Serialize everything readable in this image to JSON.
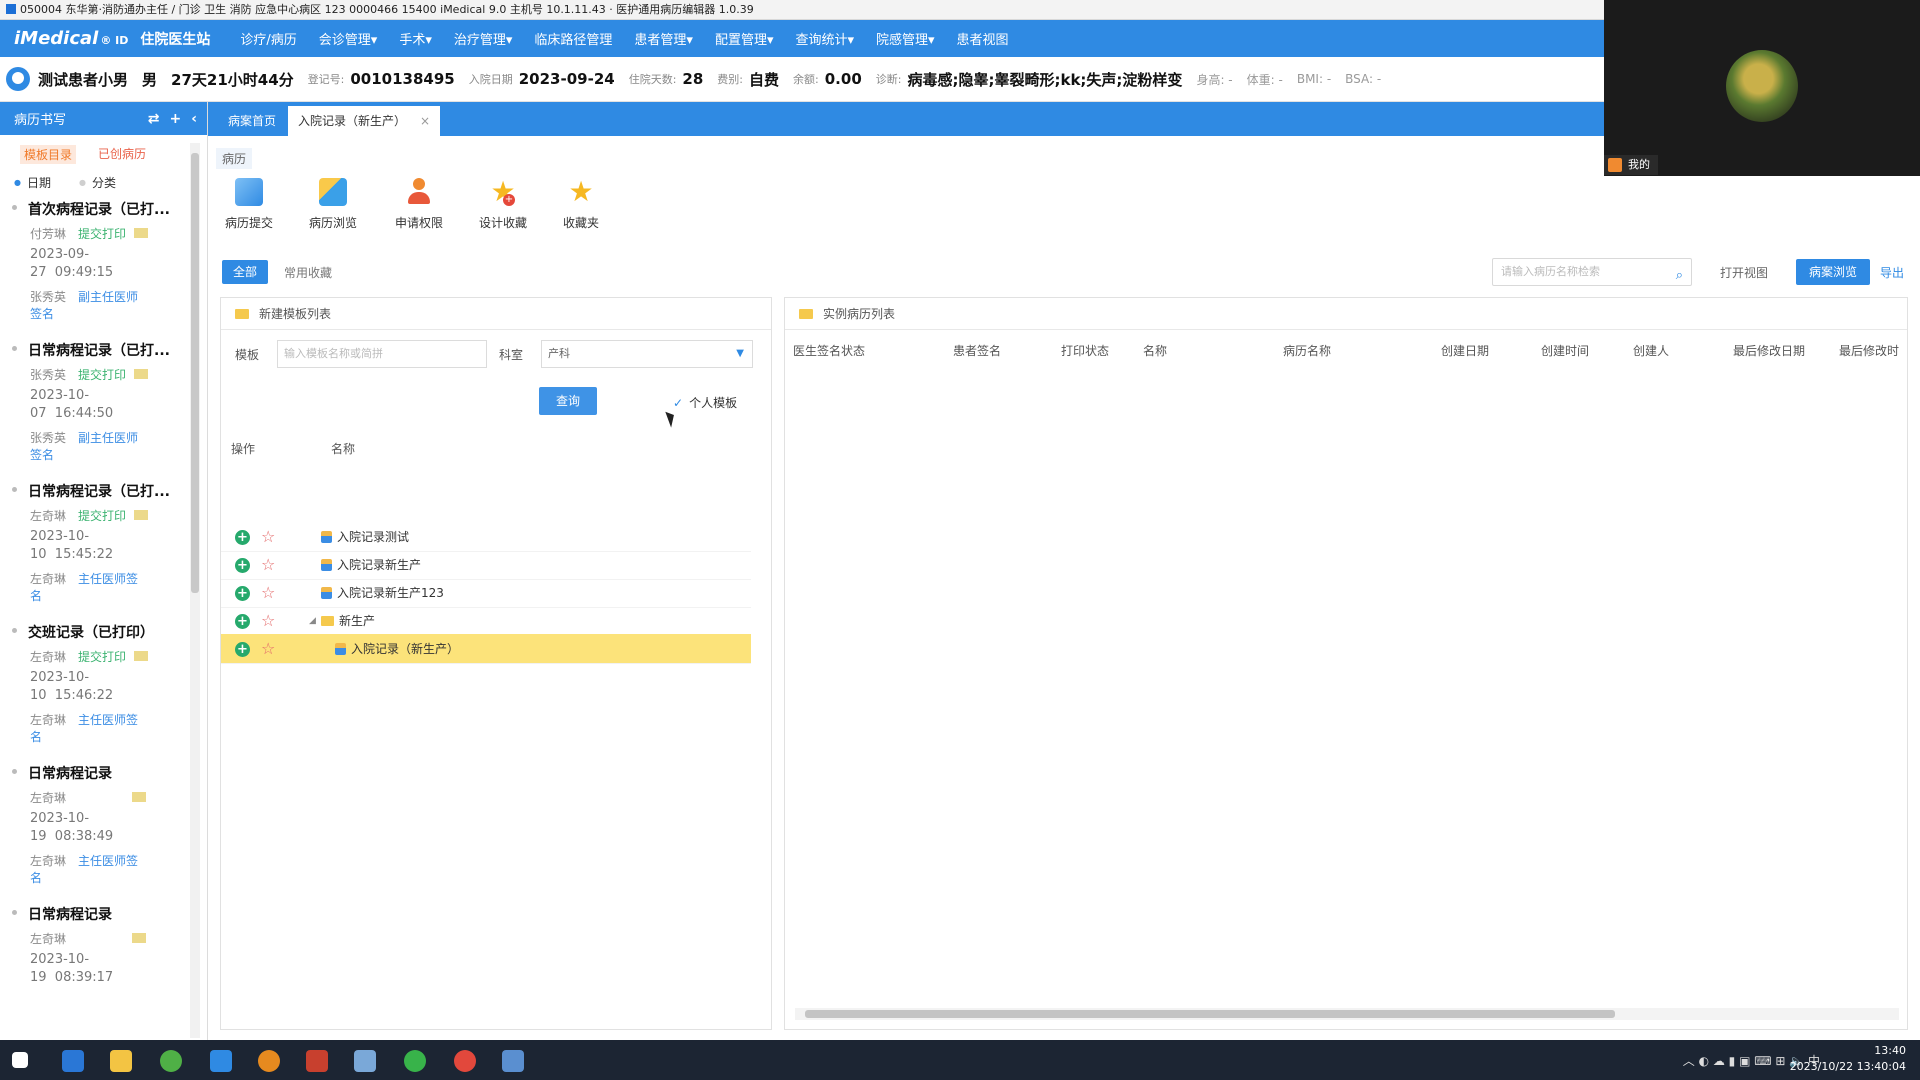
{
  "titlebar": {
    "text": "050004 东华第·消防通办主任 / 门诊 卫生 消防 应急中心病区 123 0000466 15400 iMedical 9.0 主机号 10.1.11.43 · 医护通用病历编辑器 1.0.39"
  },
  "topnav": {
    "logo": "iMedical",
    "logo_suffix": "® ID",
    "ward": "住院医生站",
    "menus": [
      "诊疗/病历",
      "会诊管理▾",
      "手术▾",
      "治疗管理▾",
      "临床路径管理",
      "患者管理▾",
      "配置管理▾",
      "查询统计▾",
      "院感管理▾",
      "患者视图"
    ]
  },
  "patient": {
    "name": "测试患者小男",
    "gender": "男",
    "age": "27天21小时44分",
    "regno_label": "登记号:",
    "regno": "0010138495",
    "admit_label": "入院日期",
    "admit_date": "2023-09-24",
    "days_label": "住院天数:",
    "days": "28",
    "fee_label": "费别:",
    "fee_type": "自费",
    "balance_label": "余额:",
    "balance": "0.00",
    "diag_label": "诊断:",
    "diagnosis": "病毒感;隐睾;睾裂畸形;kk;失声;淀粉样变",
    "height": "身高: -",
    "weight": "体重: -",
    "bmi": "BMI: -",
    "bsa": "BSA: -"
  },
  "sidebar": {
    "title": "病历书写",
    "tab_created": "模板目录",
    "tab_printed": "已创病历",
    "radio_date": "日期",
    "radio_category": "分类",
    "records": [
      {
        "title": "首次病程记录（已打...",
        "author": "付芳琳",
        "status": "提交打印",
        "date": "2023-09-\n27  09:49:15",
        "line2a": "张秀英",
        "line2b": "副主任医师",
        "line3": "签名"
      },
      {
        "title": "日常病程记录（已打...",
        "author": "张秀英",
        "status": "提交打印",
        "date": "2023-10-\n07  16:44:50",
        "line2a": "张秀英",
        "line2b": "副主任医师",
        "line3": "签名"
      },
      {
        "title": "日常病程记录（已打...",
        "author": "左奇琳",
        "status": "提交打印",
        "date": "2023-10-\n10  15:45:22",
        "line2a": "左奇琳",
        "line2b": "主任医师签",
        "line3": "名"
      },
      {
        "title": "交班记录（已打印）",
        "author": "左奇琳",
        "status": "提交打印",
        "date": "2023-10-\n10  15:46:22",
        "line2a": "左奇琳",
        "line2b": "主任医师签",
        "line3": "名"
      },
      {
        "title": "日常病程记录",
        "author": "左奇琳",
        "status": "",
        "date": "2023-10-\n19  08:38:49",
        "line2a": "左奇琳",
        "line2b": "主任医师签",
        "line3": "名"
      },
      {
        "title": "日常病程记录",
        "author": "左奇琳",
        "status": "",
        "date": "2023-10-\n19  08:39:17",
        "line2a": "",
        "line2b": "",
        "line3": ""
      }
    ]
  },
  "tabs": {
    "tab1": "病案首页",
    "tab2": "入院记录（新生产）",
    "close": "×",
    "subtab": "病历"
  },
  "toolbar": [
    "病历提交",
    "病历浏览",
    "申请权限",
    "设计收藏",
    "收藏夹"
  ],
  "filter": {
    "all": "全部",
    "favs": "常用收藏",
    "search_placeholder": "请输入病历名称检索",
    "import": "打开视图",
    "browse": "病案浏览",
    "more": "导出"
  },
  "left_panel": {
    "title": "新建模板列表",
    "template_label": "模板",
    "template_placeholder": "输入模板名称或简拼",
    "category_label": "科室",
    "category_value": "产科",
    "query": "查询",
    "personal": "个人模板",
    "col_op": "操作",
    "col_name": "名称",
    "rows": [
      {
        "name": "入院记录测试",
        "type": "doc",
        "indent": 1,
        "selected": false
      },
      {
        "name": "入院记录新生产",
        "type": "doc",
        "indent": 1,
        "selected": false
      },
      {
        "name": "入院记录新生产123",
        "type": "doc",
        "indent": 1,
        "selected": false
      },
      {
        "name": "新生产",
        "type": "folder",
        "indent": 1,
        "selected": false
      },
      {
        "name": "入院记录（新生产）",
        "type": "doc",
        "indent": 2,
        "selected": true
      }
    ]
  },
  "right_panel": {
    "title": "实例病历列表",
    "columns": [
      "医生签名状态",
      "患者签名",
      "打印状态",
      "名称",
      "病历名称",
      "创建日期",
      "创建时间",
      "创建人",
      "最后修改日期",
      "最后修改时"
    ]
  },
  "video": {
    "name": "我的"
  },
  "taskbar": {
    "time": "13:40",
    "date": "2023/10/22 13:40:04"
  }
}
